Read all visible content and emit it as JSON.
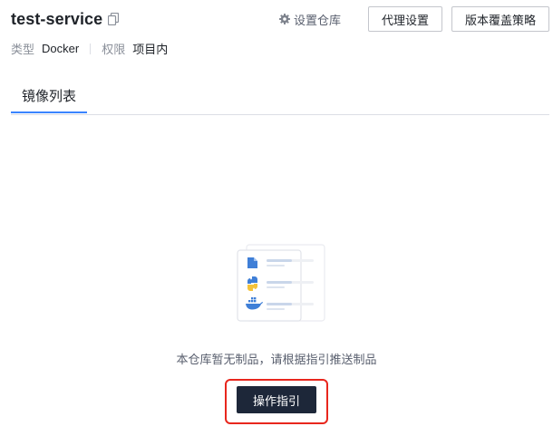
{
  "header": {
    "repo_name": "test-service",
    "copy_icon": "copy-icon",
    "repo_settings_label": "设置仓库",
    "repo_settings_icon": "gear-icon",
    "proxy_settings_label": "代理设置",
    "version_policy_label": "版本覆盖策略"
  },
  "meta": {
    "type_label": "类型",
    "type_value": "Docker",
    "permission_label": "权限",
    "permission_value": "项目内"
  },
  "tabs": [
    {
      "label": "镜像列表",
      "active": true
    }
  ],
  "empty_state": {
    "illustration_icons": [
      "file-icon",
      "python-icon",
      "docker-icon"
    ],
    "message": "本仓库暂无制品，请根据指引推送制品",
    "guide_button_label": "操作指引"
  },
  "colors": {
    "accent": "#3a84ff",
    "primary_button": "#1d2739",
    "highlight": "#e8261d"
  }
}
